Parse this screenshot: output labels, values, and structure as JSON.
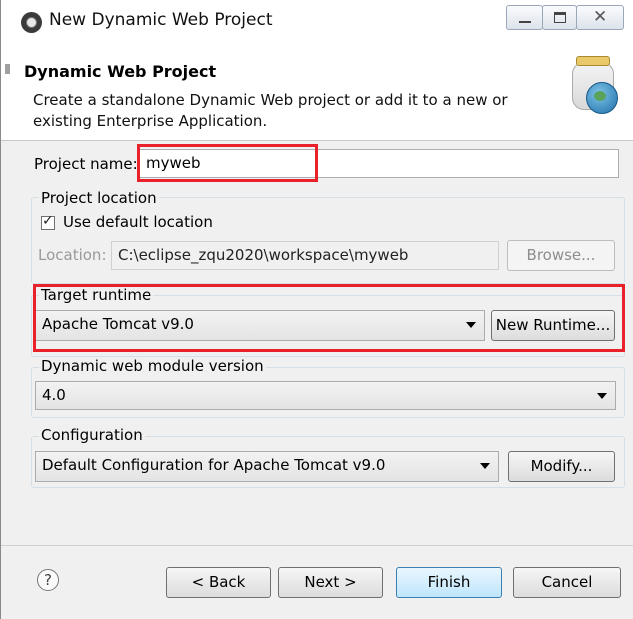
{
  "window": {
    "title": "New Dynamic Web Project",
    "close_glyph": "✕"
  },
  "header": {
    "title": "Dynamic Web Project",
    "description": "Create a standalone Dynamic Web project or add it to a new or existing Enterprise Application.",
    "icon": "web-project-jar-globe-icon"
  },
  "project_name": {
    "label": "Project name:",
    "value": "myweb"
  },
  "project_location": {
    "group_label": "Project location",
    "use_default_label": "Use default location",
    "use_default_checked": true,
    "location_label": "Location:",
    "location_value": "C:\\eclipse_zqu2020\\workspace\\myweb",
    "browse_label": "Browse..."
  },
  "target_runtime": {
    "group_label": "Target runtime",
    "selected": "Apache Tomcat v9.0",
    "new_runtime_label": "New Runtime..."
  },
  "module_version": {
    "group_label": "Dynamic web module version",
    "selected": "4.0"
  },
  "configuration": {
    "group_label": "Configuration",
    "selected": "Default Configuration for Apache Tomcat v9.0",
    "modify_label": "Modify..."
  },
  "footer": {
    "help_glyph": "?",
    "back_label": "< Back",
    "next_label": "Next >",
    "finish_label": "Finish",
    "cancel_label": "Cancel"
  },
  "colors": {
    "highlight": "#e8212b",
    "primary_button": "#bee6fd"
  }
}
